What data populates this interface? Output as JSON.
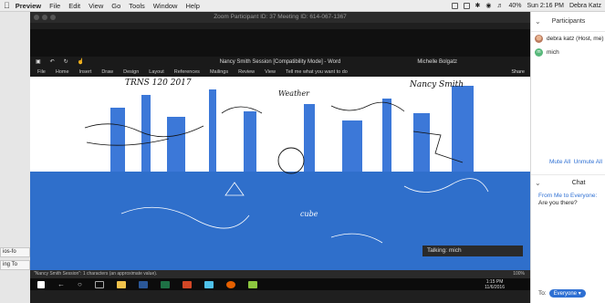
{
  "menubar": {
    "app": "Preview",
    "items": [
      "File",
      "Edit",
      "View",
      "Go",
      "Tools",
      "Window",
      "Help"
    ],
    "battery": "40%",
    "clock": "Sun 2:16 PM",
    "user": "Debra Katz"
  },
  "desktop_tabs": [
    "ios-fo",
    "ing To"
  ],
  "zoom": {
    "title": "Zoom Participant ID: 37   Meeting ID: 614-067-1367",
    "talking": "Talking: mich"
  },
  "word": {
    "title": "Nancy Smith Session [Compatibility Mode] - Word",
    "user": "Michelle Bolgatz",
    "ribbon_tabs": [
      "File",
      "Home",
      "Insert",
      "Draw",
      "Design",
      "Layout",
      "References",
      "Mailings",
      "Review",
      "View",
      "Tell me what you want to do"
    ],
    "share_label": "Share",
    "status": "\"Nancy Smith Session\": 1 characters (an approximate value).",
    "zoom_level": "100%",
    "taskbar_time": "1:15 PM",
    "taskbar_date": "11/6/2016"
  },
  "doc": {
    "handwriting": [
      "TRNS 120 2017",
      "Weather",
      "Nancy Smith",
      "cube"
    ]
  },
  "panel": {
    "participants_header": "Participants",
    "participants": [
      {
        "name": "debra katz (Host, me)",
        "avatar": "photo"
      },
      {
        "name": "mich",
        "avatar": "initial",
        "initial": "m"
      }
    ],
    "mute_all": "Mute All",
    "unmute_all": "Unmute All",
    "chat_header": "Chat",
    "chat_from": "From Me to Everyone:",
    "chat_text": "Are you there?",
    "to_label": "To:",
    "to_value": "Everyone"
  },
  "colors": {
    "zoom_blue": "#2d6fd3",
    "doc_blue": "#2f6fcb"
  }
}
